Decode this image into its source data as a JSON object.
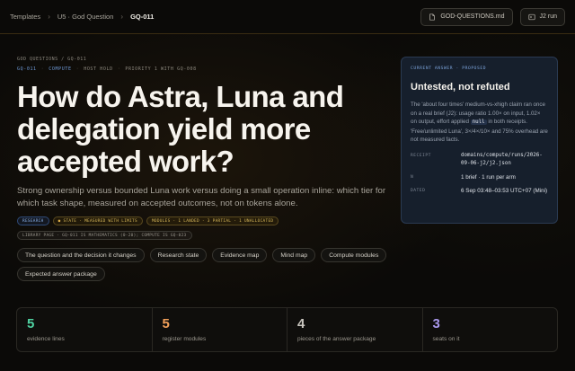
{
  "breadcrumb": {
    "items": [
      "Templates",
      "U5 · God Question",
      "GQ-011"
    ]
  },
  "top_actions": {
    "file_label": "GOD-QUESTIONS.md",
    "run_label": "J2 run"
  },
  "header": {
    "kicker": "GOD QUESTIONS / GQ-011",
    "meta": [
      "GQ-011",
      "COMPUTE",
      "HOST HOLD",
      "PRIORITY 1 WITH GQ-008"
    ],
    "title": "How do Astra, Luna and delegation yield more accepted work?",
    "subtitle": "Strong ownership versus bounded Luna work versus doing a small operation inline: which tier for which task shape, measured on accepted outcomes, not on tokens alone."
  },
  "chips": {
    "research": "RESEARCH",
    "state": "STATE · MEASURED WITH LIMITS",
    "modules": "MODULES · 1 LANDED · 3 PARTIAL · 1 UNALLOCATED",
    "library": "LIBRARY PAGE · GQ-011 IS MATHEMATICS (0-20); COMPUTE IS GQ-023"
  },
  "nav_buttons": [
    "The question and the decision it changes",
    "Research state",
    "Evidence map",
    "Mind map",
    "Compute modules",
    "Expected answer package"
  ],
  "answer_card": {
    "kicker": "CURRENT ANSWER · PROPOSED",
    "title": "Untested, not refuted",
    "body_1": "The 'about four times' medium-vs-xhigh claim ran once on a real brief (J2): usage ratio 1.00× on input, 1.02× on output, effort applied ",
    "body_code": "null",
    "body_2": " in both receipts. 'Free/unlimited Luna', 3×/4×/10× and 75% overhead are not measured facts.",
    "receipt_label": "RECEIPT",
    "receipt_value": "domains/compute/runs/2026-09-06-j2/j2.json",
    "n_label": "N",
    "n_value": "1 brief · 1 run per arm",
    "dated_label": "DATED",
    "dated_value": "6 Sep 03:48–03:53 UTC+07 (Mini)"
  },
  "stats": [
    {
      "num": "5",
      "label": "evidence lines",
      "color": "#4fd1a1"
    },
    {
      "num": "5",
      "label": "register modules",
      "color": "#f2a05a"
    },
    {
      "num": "4",
      "label": "pieces of the answer package",
      "color": "#c9c6bf"
    },
    {
      "num": "3",
      "label": "seats on it",
      "color": "#a998ec"
    }
  ]
}
